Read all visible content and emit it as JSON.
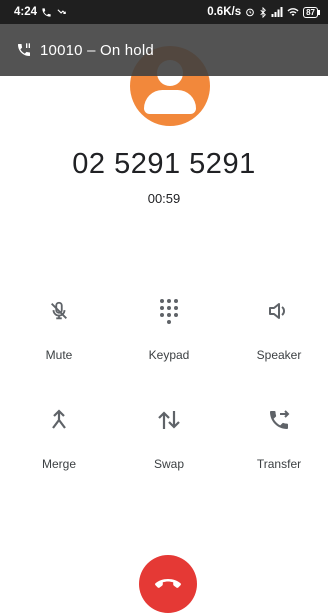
{
  "status_bar": {
    "time": "4:24",
    "network_speed": "0.6K/s",
    "battery": "87",
    "icons": [
      "call-icon",
      "missed-call-icon",
      "alarm-icon",
      "bluetooth-icon",
      "signal-icon",
      "wifi-icon",
      "battery-icon"
    ]
  },
  "hold_banner": {
    "text": "10010 – On hold",
    "icon": "phone-paused-icon"
  },
  "call": {
    "number": "02   5291 5291",
    "duration": "00:59"
  },
  "controls": [
    {
      "label": "Mute",
      "icon": "mic-off-icon"
    },
    {
      "label": "Keypad",
      "icon": "dialpad-icon"
    },
    {
      "label": "Speaker",
      "icon": "volume-icon"
    },
    {
      "label": "Merge",
      "icon": "merge-icon"
    },
    {
      "label": "Swap",
      "icon": "swap-icon"
    },
    {
      "label": "Transfer",
      "icon": "phone-forward-icon"
    }
  ],
  "colors": {
    "avatar": "#f2883b",
    "end_call": "#e53935",
    "banner": "#404040"
  },
  "end_call": {
    "icon": "call-end-icon"
  }
}
